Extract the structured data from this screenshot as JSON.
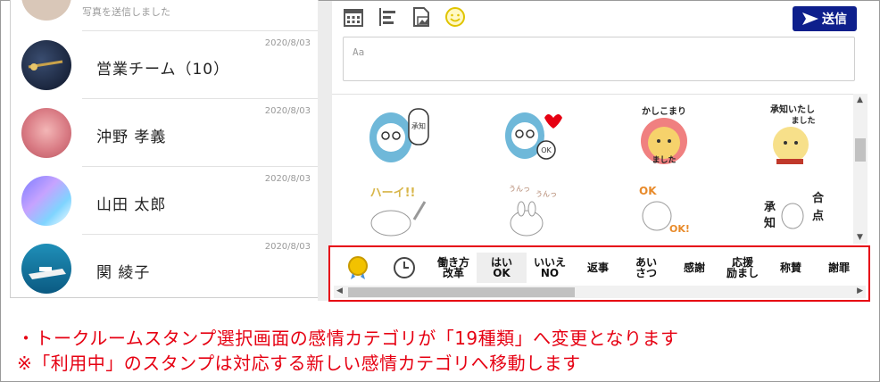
{
  "chat_list": {
    "top_partial_sub": "写真を送信しました",
    "items": [
      {
        "name": "営業チーム（10）",
        "date": "2020/8/03"
      },
      {
        "name": "沖野 孝義",
        "date": "2020/8/03"
      },
      {
        "name": "山田 太郎",
        "date": "2020/8/03"
      },
      {
        "name": "関 綾子",
        "date": "2020/8/03"
      }
    ]
  },
  "composer": {
    "send_label": "送信",
    "input_placeholder": "Aa",
    "toolbar_icons": [
      "calendar-icon",
      "align-left-icon",
      "image-icon",
      "emoji-icon"
    ]
  },
  "stamps": [
    {
      "name": "stamp-hood-shoushi"
    },
    {
      "name": "stamp-hood-ok"
    },
    {
      "name": "stamp-bear-kashikomari",
      "text": "かしこまりました"
    },
    {
      "name": "stamp-bear-shouchi",
      "text": "承知いたしました"
    },
    {
      "name": "stamp-rabbit-hai",
      "text": "ハーイ!!"
    },
    {
      "name": "stamp-rabbit-un",
      "text": "うんっうんっ"
    },
    {
      "name": "stamp-rabbit-ok",
      "text": "OK OK!"
    },
    {
      "name": "stamp-rabbit-shouchi",
      "text": "承知 合点"
    }
  ],
  "categories": [
    {
      "label": "",
      "icon": "medal-icon"
    },
    {
      "label": "",
      "icon": "clock-icon"
    },
    {
      "label": "働き方\n改革"
    },
    {
      "label": "はい\nOK",
      "active": true
    },
    {
      "label": "いいえ\nNO"
    },
    {
      "label": "返事"
    },
    {
      "label": "あい\nさつ"
    },
    {
      "label": "感謝"
    },
    {
      "label": "応援\n励まし"
    },
    {
      "label": "称賛"
    },
    {
      "label": "謝罪"
    }
  ],
  "notice": {
    "line1": "・トークルームスタンプ選択画面の感情カテゴリが「19種類」へ変更となります",
    "line2": "※「利用中」のスタンプは対応する新しい感情カテゴリへ移動します"
  },
  "colors": {
    "accent_red": "#e60012",
    "send_blue": "#0e1f8c"
  }
}
